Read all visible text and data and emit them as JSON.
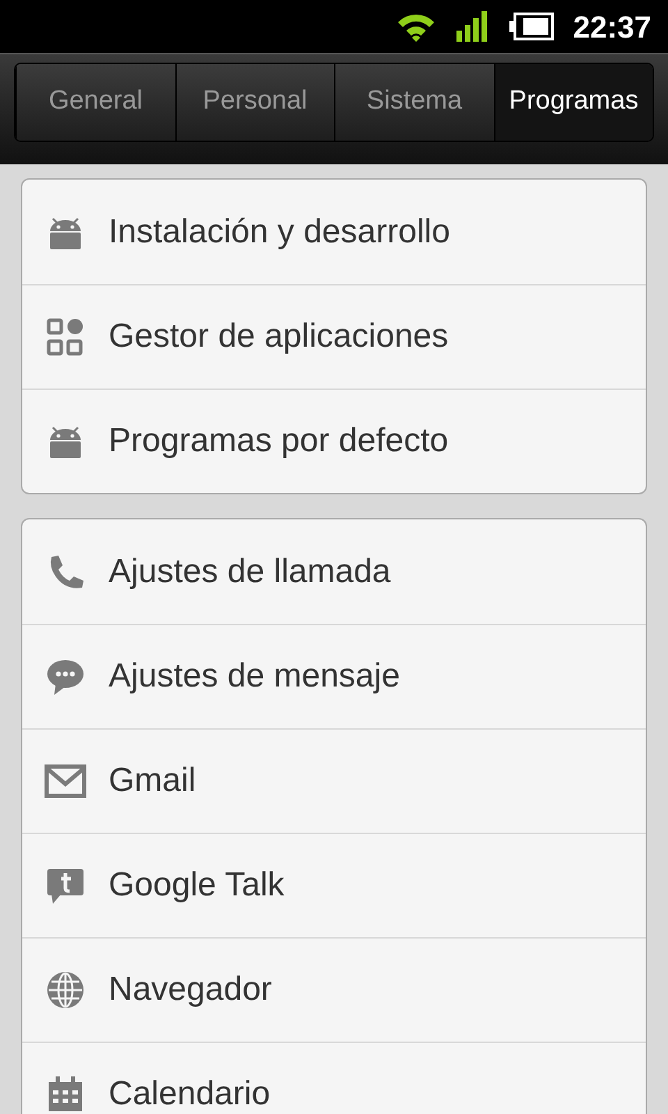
{
  "status_bar": {
    "time": "22:37"
  },
  "tabs": [
    {
      "label": "General",
      "selected": false
    },
    {
      "label": "Personal",
      "selected": false
    },
    {
      "label": "Sistema",
      "selected": false
    },
    {
      "label": "Programas",
      "selected": true
    }
  ],
  "groups": [
    {
      "items": [
        {
          "kind": "android",
          "label": "Instalación y desarrollo"
        },
        {
          "kind": "grid",
          "label": "Gestor de aplicaciones"
        },
        {
          "kind": "android",
          "label": "Programas por defecto"
        }
      ]
    },
    {
      "items": [
        {
          "kind": "phone",
          "label": "Ajustes de llamada"
        },
        {
          "kind": "chat",
          "label": "Ajustes de mensaje"
        },
        {
          "kind": "mail",
          "label": "Gmail"
        },
        {
          "kind": "talk",
          "label": "Google Talk"
        },
        {
          "kind": "globe",
          "label": "Navegador"
        },
        {
          "kind": "calendar",
          "label": "Calendario"
        }
      ]
    }
  ]
}
